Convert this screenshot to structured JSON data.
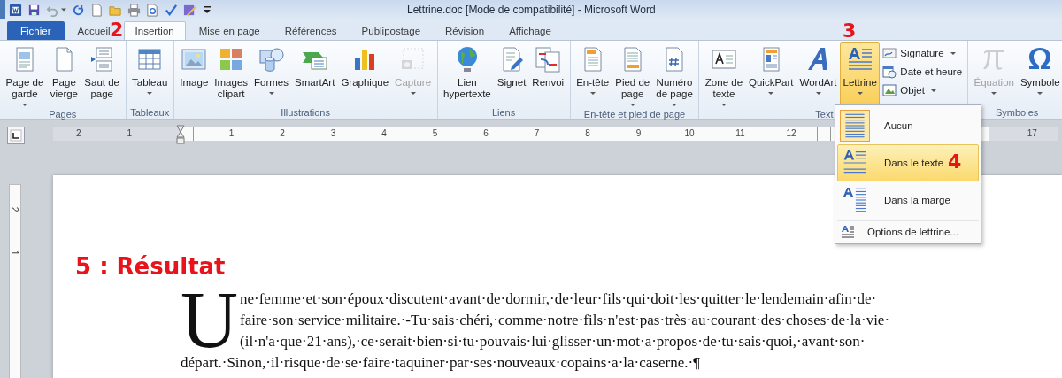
{
  "window": {
    "title": "Lettrine.doc [Mode de compatibilité]  -  Microsoft Word"
  },
  "tabs": [
    {
      "label": "Fichier",
      "kind": "file",
      "selected": false
    },
    {
      "label": "Accueil",
      "kind": "tab",
      "selected": false
    },
    {
      "label": "Insertion",
      "kind": "tab",
      "selected": true
    },
    {
      "label": "Mise en page",
      "kind": "tab",
      "selected": false
    },
    {
      "label": "Références",
      "kind": "tab",
      "selected": false
    },
    {
      "label": "Publipostage",
      "kind": "tab",
      "selected": false
    },
    {
      "label": "Révision",
      "kind": "tab",
      "selected": false
    },
    {
      "label": "Affichage",
      "kind": "tab",
      "selected": false
    }
  ],
  "ribbon": [
    {
      "label": "Pages",
      "buttons": [
        {
          "lines": [
            "Page de",
            "garde"
          ],
          "dropdown": true,
          "disabled": false,
          "selected": false
        },
        {
          "lines": [
            "Page",
            "vierge"
          ],
          "dropdown": false,
          "disabled": false,
          "selected": false
        },
        {
          "lines": [
            "Saut de",
            "page"
          ],
          "dropdown": false,
          "disabled": false,
          "selected": false
        }
      ]
    },
    {
      "label": "Tableaux",
      "buttons": [
        {
          "lines": [
            "Tableau"
          ],
          "dropdown": true,
          "disabled": false,
          "selected": false
        }
      ]
    },
    {
      "label": "Illustrations",
      "buttons": [
        {
          "lines": [
            "Image"
          ],
          "dropdown": false,
          "disabled": false,
          "selected": false
        },
        {
          "lines": [
            "Images",
            "clipart"
          ],
          "dropdown": false,
          "disabled": false,
          "selected": false
        },
        {
          "lines": [
            "Formes"
          ],
          "dropdown": true,
          "disabled": false,
          "selected": false
        },
        {
          "lines": [
            "SmartArt"
          ],
          "dropdown": false,
          "disabled": false,
          "selected": false
        },
        {
          "lines": [
            "Graphique"
          ],
          "dropdown": false,
          "disabled": false,
          "selected": false
        },
        {
          "lines": [
            "Capture"
          ],
          "dropdown": true,
          "disabled": true,
          "selected": false
        }
      ]
    },
    {
      "label": "Liens",
      "buttons": [
        {
          "lines": [
            "Lien",
            "hypertexte"
          ],
          "dropdown": false,
          "disabled": false,
          "selected": false
        },
        {
          "lines": [
            "Signet"
          ],
          "dropdown": false,
          "disabled": false,
          "selected": false
        },
        {
          "lines": [
            "Renvoi"
          ],
          "dropdown": false,
          "disabled": false,
          "selected": false
        }
      ]
    },
    {
      "label": "En-tête et pied de page",
      "buttons": [
        {
          "lines": [
            "En-tête"
          ],
          "dropdown": true,
          "disabled": false,
          "selected": false
        },
        {
          "lines": [
            "Pied de",
            "page"
          ],
          "dropdown": true,
          "disabled": false,
          "selected": false
        },
        {
          "lines": [
            "Numéro",
            "de page"
          ],
          "dropdown": true,
          "disabled": false,
          "selected": false
        }
      ]
    },
    {
      "label": "Text",
      "buttons": [
        {
          "lines": [
            "Zone de",
            "texte"
          ],
          "dropdown": true,
          "disabled": false,
          "selected": false
        },
        {
          "lines": [
            "QuickPart"
          ],
          "dropdown": true,
          "disabled": false,
          "selected": false
        },
        {
          "lines": [
            "WordArt"
          ],
          "dropdown": true,
          "disabled": false,
          "selected": false
        },
        {
          "lines": [
            "Lettrine"
          ],
          "dropdown": true,
          "disabled": false,
          "selected": true
        }
      ],
      "small_buttons": [
        {
          "label": "Signature",
          "dropdown": true
        },
        {
          "label": "Date et heure",
          "dropdown": false
        },
        {
          "label": "Objet",
          "dropdown": true
        }
      ]
    },
    {
      "label": "Symboles",
      "buttons": [
        {
          "lines": [
            "Équation"
          ],
          "dropdown": true,
          "disabled": true,
          "selected": false
        },
        {
          "lines": [
            "Symbole"
          ],
          "dropdown": true,
          "disabled": false,
          "selected": false
        }
      ]
    }
  ],
  "ruler": {
    "left_numbers": [
      "2",
      "1"
    ],
    "numbers": [
      "1",
      "2",
      "3",
      "4",
      "5",
      "6",
      "7",
      "8",
      "9",
      "10",
      "11",
      "12"
    ],
    "end_number": "17",
    "vertical_numbers": [
      "2",
      "1"
    ]
  },
  "dropcap_menu": {
    "items": [
      {
        "label": "Aucun",
        "selected": false,
        "checked": true
      },
      {
        "label": "Dans le texte",
        "selected": true,
        "checked": false
      },
      {
        "label": "Dans la marge",
        "selected": false,
        "checked": false
      }
    ],
    "options": "Options de lettrine..."
  },
  "annotations": {
    "tab_step": "2",
    "button_step": "3",
    "menu_step": "4",
    "result": "5 : Résultat"
  },
  "document": {
    "drop_cap": "U",
    "lines": [
      "ne·femme·et·son·époux·discutent·avant·de·dormir,·de·leur·fils·qui·doit·les·quitter·le·lendemain·afin·de·",
      "faire·son·service·militaire.·-Tu·sais·chéri,·comme·notre·fils·n'est·pas·très·au·courant·des·choses·de·la·vie·",
      "(il·n'a·que·21·ans),·ce·serait·bien·si·tu·pouvais·lui·glisser·un·mot·a·propos·de·tu·sais·quoi,·avant·son·",
      "départ.·Sinon,·il·risque·de·se·faire·taquiner·par·ses·nouveaux·copains·a·la·caserne.·¶"
    ]
  }
}
